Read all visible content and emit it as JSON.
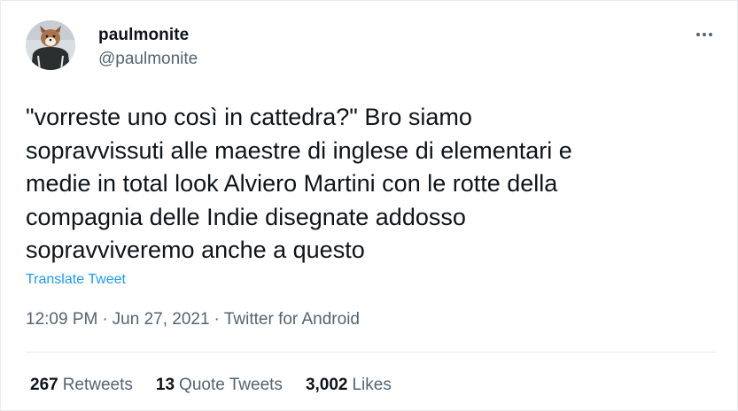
{
  "author": {
    "display_name": "paulmonite",
    "handle": "@paulmonite"
  },
  "tweet": {
    "text": "\"vorreste uno così in cattedra?\" Bro siamo\nsopravvissuti alle maestre di inglese di elementari e\nmedie in total look Alviero Martini con le rotte della\ncompagnia delle Indie disegnate addosso\nsopravviveremo anche a questo",
    "translate_label": "Translate Tweet",
    "time": "12:09 PM",
    "separator": "·",
    "date": "Jun 27, 2021",
    "source": "Twitter for Android"
  },
  "stats": {
    "retweets_count": "267",
    "retweets_label": "Retweets",
    "quotes_count": "13",
    "quotes_label": "Quote Tweets",
    "likes_count": "3,002",
    "likes_label": "Likes"
  },
  "icons": {
    "more": "more-horizontal-icon"
  },
  "colors": {
    "link": "#1d9bf0",
    "text": "#0f1419",
    "secondary": "#536471",
    "border": "#e6ecf0"
  }
}
